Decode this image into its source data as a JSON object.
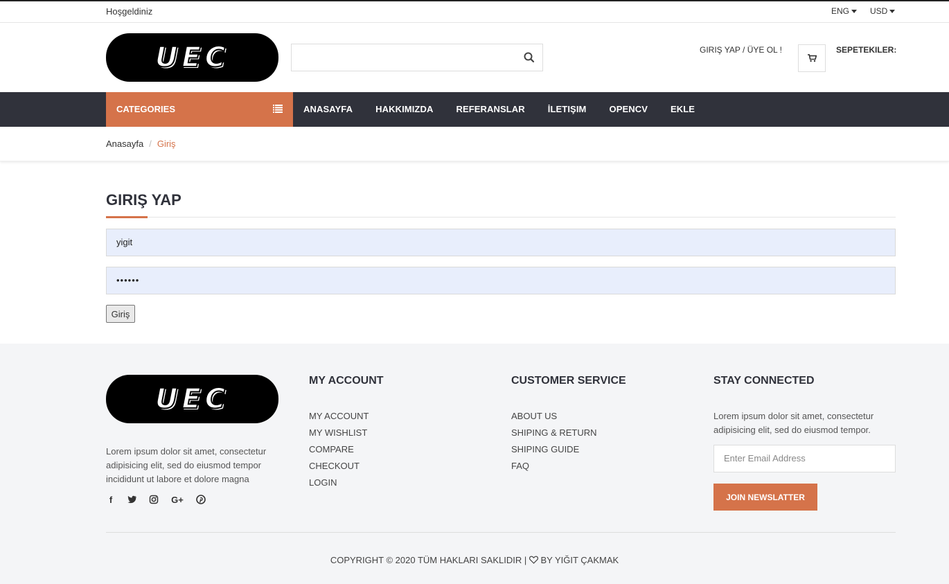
{
  "topbar": {
    "welcome": "Hoşgeldiniz",
    "language": "ENG",
    "currency": "USD"
  },
  "header": {
    "logo_text": "UEC",
    "search_placeholder": "",
    "login_link": "GIRIŞ YAP / ÜYE OL !",
    "cart_label": "SEPETEKILER:"
  },
  "nav": {
    "categories_label": "CATEGORIES",
    "links": [
      "ANASAYFA",
      "HAKKIMIZDA",
      "REFERANSLAR",
      "İLETIŞIM",
      "OPENCV",
      "EKLE"
    ]
  },
  "breadcrumb": {
    "home": "Anasayfa",
    "current": "Giriş"
  },
  "login_form": {
    "title": "GIRIŞ YAP",
    "username_value": "yigit",
    "password_value": "••••••",
    "submit_label": "Giriş"
  },
  "footer": {
    "logo_text": "UEC",
    "description": "Lorem ipsum dolor sit amet, consectetur adipisicing elit, sed do eiusmod tempor incididunt ut labore et dolore magna",
    "social_icons": [
      "facebook-icon",
      "twitter-icon",
      "instagram-icon",
      "google-plus-icon",
      "pinterest-icon"
    ],
    "my_account": {
      "heading": "MY ACCOUNT",
      "items": [
        "MY ACCOUNT",
        "MY WISHLIST",
        "COMPARE",
        "CHECKOUT",
        "LOGIN"
      ]
    },
    "customer_service": {
      "heading": "CUSTOMER SERVICE",
      "items": [
        "ABOUT US",
        "SHIPING & RETURN",
        "SHIPING GUIDE",
        "FAQ"
      ]
    },
    "stay_connected": {
      "heading": "STAY CONNECTED",
      "text": "Lorem ipsum dolor sit amet, consectetur adipisicing elit, sed do eiusmod tempor.",
      "email_placeholder": "Enter Email Address",
      "join_label": "JOIN NEWSLATTER"
    },
    "copyright_left": "COPYRIGHT © 2020 TÜM HAKLARI SAKLIDIR |",
    "copyright_right": "BY YIĞIT ÇAKMAK"
  },
  "colors": {
    "accent": "#d5734a",
    "nav_bg": "#30323b",
    "footer_bg": "#f4f5f7",
    "input_bg": "#e8eefc"
  }
}
